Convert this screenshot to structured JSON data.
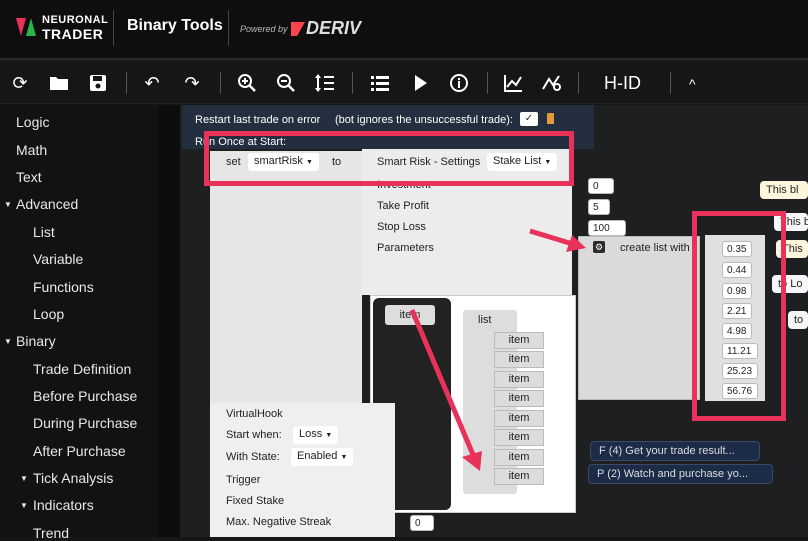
{
  "header": {
    "brand_line1": "NEURONAL",
    "brand_line2": "TRADER",
    "title": "Binary Tools",
    "powered_by": "Powered by",
    "partner": "DERIV",
    "colors": {
      "logo_red": "#e8325a",
      "logo_green": "#2bb34a",
      "background": "#0e0e0e"
    }
  },
  "toolbar": {
    "icons": [
      "reset-icon",
      "open-folder-icon",
      "save-icon",
      "undo-icon",
      "redo-icon",
      "zoom-in-icon",
      "zoom-out-icon",
      "sort-icon",
      "summary-list-icon",
      "play-icon",
      "info-icon",
      "chart-icon",
      "indicators-icon"
    ],
    "hid_label": "H-ID",
    "collapse_label": "^"
  },
  "sidebar": {
    "items": [
      {
        "label": "Logic"
      },
      {
        "label": "Math"
      },
      {
        "label": "Text"
      },
      {
        "label": "Advanced"
      },
      {
        "label": "List"
      },
      {
        "label": "Variable"
      },
      {
        "label": "Functions"
      },
      {
        "label": "Loop"
      },
      {
        "label": "Binary"
      },
      {
        "label": "Trade Definition"
      },
      {
        "label": "Before Purchase"
      },
      {
        "label": "During Purchase"
      },
      {
        "label": "After Purchase"
      },
      {
        "label": "Tick Analysis"
      },
      {
        "label": "Indicators"
      },
      {
        "label": "Trend"
      }
    ]
  },
  "workspace": {
    "restart_label": "Restart last trade on error",
    "restart_note": "(bot ignores the unsuccessful trade):",
    "run_once_label": "Run Once at Start:",
    "set_label": "set",
    "set_variable": "smartRisk",
    "to_label": "to",
    "smart_risk_label": "Smart Risk - Settings",
    "stake_list_option": "Stake List",
    "investment_label": "Investment",
    "investment_value": "0",
    "take_profit_label": "Take Profit",
    "take_profit_value": "5",
    "stop_loss_label": "Stop Loss",
    "stop_loss_value": "100",
    "parameters_label": "Parameters",
    "create_list_label": "create list with",
    "list_values": [
      "0.35",
      "0.44",
      "0.98",
      "2.21",
      "4.98",
      "11.21",
      "25.23",
      "56.76"
    ],
    "mutator": {
      "item_label": "item",
      "list_label": "list",
      "items": [
        "item",
        "item",
        "item",
        "item",
        "item",
        "item",
        "item",
        "item"
      ]
    },
    "virtual_hook": {
      "title": "VirtualHook",
      "start_when_label": "Start when:",
      "start_when_value": "Loss",
      "with_state_label": "With State:",
      "with_state_value": "Enabled",
      "trigger_label": "Trigger",
      "fixed_stake_label": "Fixed Stake",
      "max_negative_streak_label": "Max. Negative Streak",
      "max_negative_streak_value": "0"
    },
    "side_blocks": [
      "This bl",
      "This bl",
      "This",
      "to Lo",
      "to"
    ],
    "trade_blocks": [
      {
        "label": "F (4) Get your trade result..."
      },
      {
        "label": "P (2) Watch and purchase yo..."
      }
    ],
    "highlight_color": "#e8325a"
  }
}
